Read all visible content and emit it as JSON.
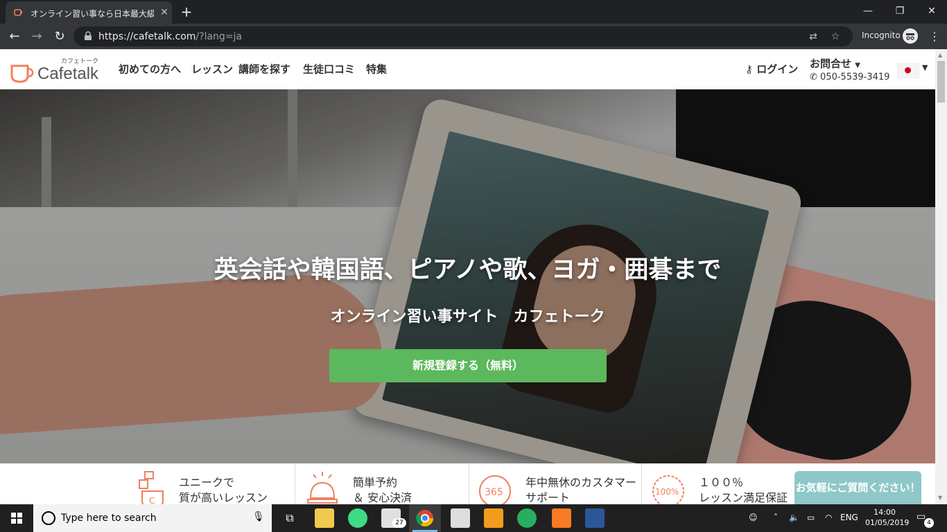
{
  "browser": {
    "tab_title": "オンライン習い事なら日本最大級のオ",
    "tab_close": "✕",
    "new_tab": "+",
    "window_controls": [
      "—",
      "❐",
      "✕"
    ],
    "url_host": "https://cafetalk.com",
    "url_path": "/?lang=ja",
    "incognito_label": "Incognito",
    "icons": [
      "back-icon",
      "forward-icon",
      "reload-icon",
      "lock-icon",
      "translate-icon",
      "star-icon",
      "incognito-icon",
      "menu-icon"
    ]
  },
  "header": {
    "logo_small": "カフェトーク",
    "logo_text": "Cafetalk",
    "nav": [
      "初めての方へ",
      "レッスン",
      "講師を探す",
      "生徒口コミ",
      "特集"
    ],
    "login": "ログイン",
    "contact": "お問合せ",
    "phone": "050-5539-3419"
  },
  "hero": {
    "title": "英会話や韓国語、ピアノや歌、ヨガ・囲碁まで",
    "subtitle": "オンライン習い事サイト　カフェトーク",
    "cta": "新規登録する（無料）",
    "cta_color": "#5cb85c"
  },
  "features": [
    {
      "line1": "ユニークで",
      "line2": "質が高いレッスン",
      "icon": "lesson-icon"
    },
    {
      "line1": "簡単予約",
      "line2": "＆ 安心決済",
      "icon": "bell-icon"
    },
    {
      "line1": "年中無休のカスタマー",
      "line2": "サポート",
      "icon": "support-365-icon",
      "icon_text": "365"
    },
    {
      "line1": "１００％",
      "line2": "レッスン満足保証",
      "icon": "guarantee-100-icon",
      "icon_text": "100%"
    }
  ],
  "chat_button": "お気軽にご質問ください！",
  "accent_color": "#f0805f",
  "taskbar": {
    "search_placeholder": "Type here to search",
    "mail_badge": "27",
    "language": "ENG",
    "time": "14:00",
    "date": "01/05/2019",
    "notification_badge": "4"
  }
}
